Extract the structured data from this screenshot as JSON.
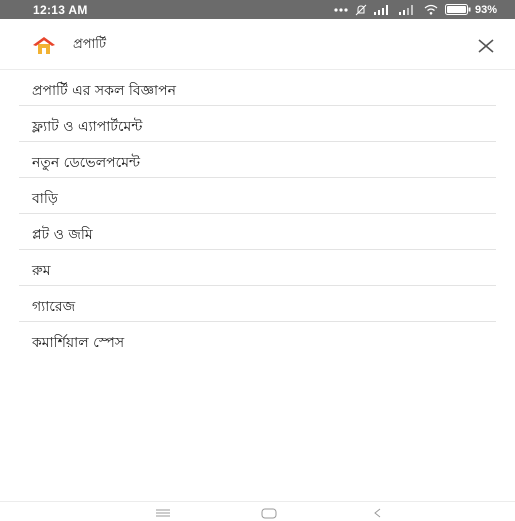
{
  "status_bar": {
    "time": "12:13 AM",
    "battery": "93%"
  },
  "header": {
    "title": "প্রপার্টি"
  },
  "menu": {
    "items": [
      {
        "label": "প্রপার্টি এর সকল বিজ্ঞাপন"
      },
      {
        "label": "ফ্ল্যাট ও এ্যাপার্টমেন্ট"
      },
      {
        "label": "নতুন ডেভেলপমেন্ট"
      },
      {
        "label": "বাড়ি"
      },
      {
        "label": "প্লট ও জমি"
      },
      {
        "label": "রুম"
      },
      {
        "label": "গ্যারেজ"
      },
      {
        "label": "কমার্শিয়াল স্পেস"
      }
    ]
  },
  "colors": {
    "status_bar_bg": "#6b6b6b",
    "home_roof": "#e8452c",
    "home_body": "#f2b233",
    "divider": "#e3e3e3"
  },
  "icons": {
    "home": "home-icon",
    "close": "close-icon",
    "nav_menu": "menu-icon",
    "nav_home": "square-icon",
    "nav_back": "back-icon"
  }
}
